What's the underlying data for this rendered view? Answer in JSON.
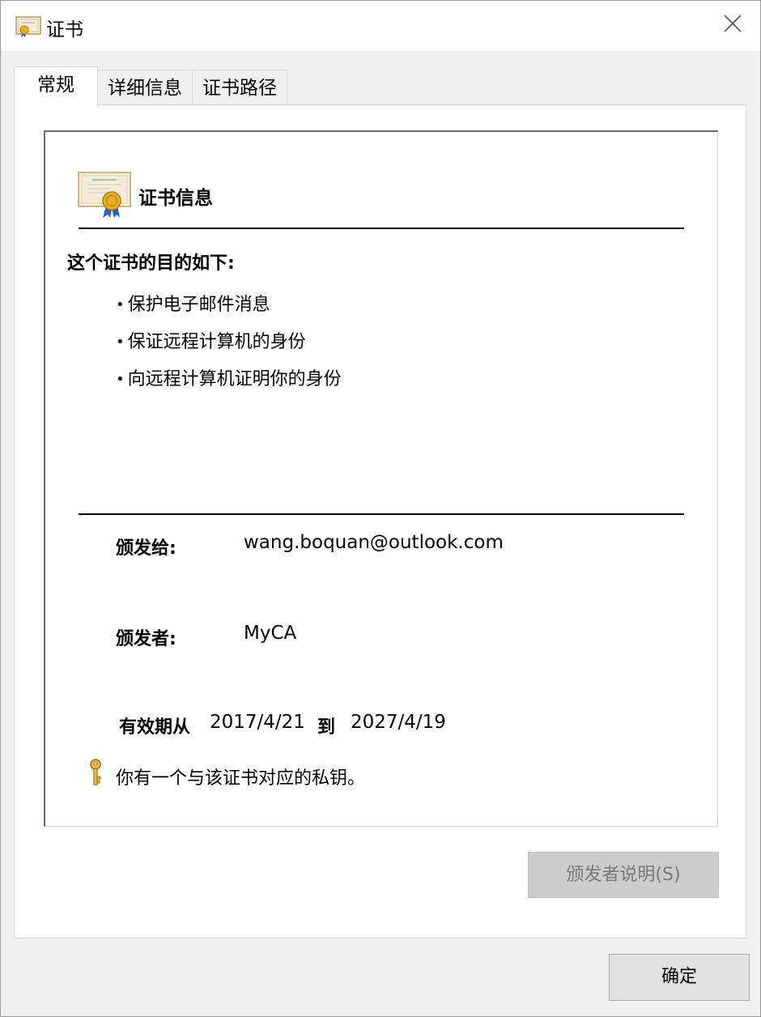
{
  "window": {
    "title": "证书",
    "close_glyph": "✕",
    "title_icon": "certificate-icon",
    "close_icon": "close-icon"
  },
  "tabs": [
    {
      "label": "常规",
      "active": true
    },
    {
      "label": "详细信息",
      "active": false
    },
    {
      "label": "证书路径",
      "active": false
    }
  ],
  "general": {
    "heading": "证书信息",
    "heading_icon": "certificate-icon",
    "purpose_title": "这个证书的目的如下:",
    "bullet": "•",
    "purposes": [
      "保护电子邮件消息",
      "保证远程计算机的身份",
      "向远程计算机证明你的身份"
    ],
    "issued_to": {
      "label": "颁发给:",
      "value": "wang.boquan@outlook.com"
    },
    "issued_by": {
      "label": "颁发者:",
      "value": "MyCA"
    },
    "validity": {
      "from_label": "有效期从",
      "from": "2017/4/21",
      "to_label": "到",
      "to": "2027/4/19"
    },
    "private_key": {
      "icon": "key-icon",
      "text": "你有一个与该证书对应的私钥。"
    },
    "issuer_statement_button": {
      "label": "颁发者说明(S)",
      "enabled": false
    }
  },
  "footer": {
    "ok_label": "确定"
  },
  "colors": {
    "disabled_button_bg": "#cccccc",
    "disabled_text": "#7a7a7a",
    "seal_gold": "#e8b020",
    "ribbon_blue": "#2a5fd0"
  }
}
